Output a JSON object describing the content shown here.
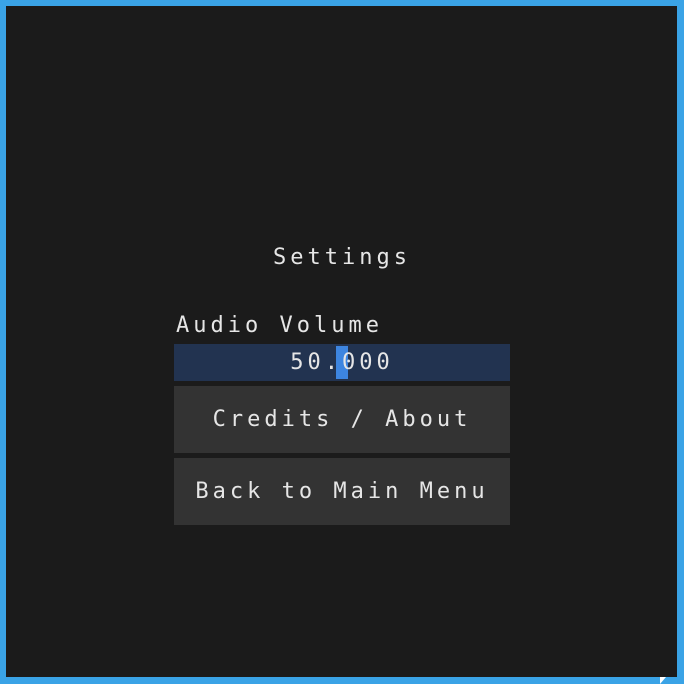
{
  "colors": {
    "border": "#3aa3e6",
    "background": "#1b1b1b",
    "slider_bg": "#223350",
    "slider_grab": "#3d85e0",
    "button": "#333333",
    "text": "#e6e6e6"
  },
  "settings": {
    "title": "Settings",
    "audio_volume": {
      "label": "Audio Volume",
      "value_text": "50.000",
      "value": 50,
      "min": 0,
      "max": 100
    },
    "credits_button": "Credits / About",
    "back_button": "Back to Main Menu"
  }
}
